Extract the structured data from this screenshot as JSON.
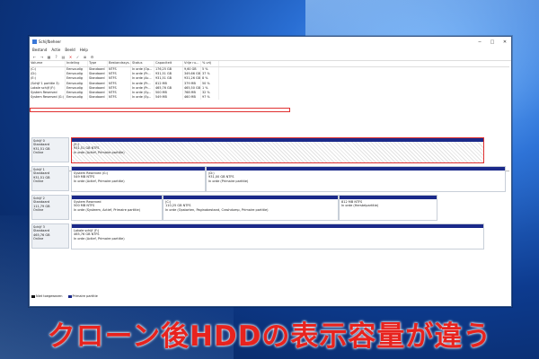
{
  "window": {
    "title": "Schijfbeheer"
  },
  "menu": [
    "Bestand",
    "Actie",
    "Beeld",
    "Help"
  ],
  "toolbar": [
    "back-icon",
    "forward-icon",
    "grid-icon",
    "help-icon",
    "properties-icon",
    "delete-icon",
    "check-icon",
    "list-icon",
    "settings-icon"
  ],
  "volumes": {
    "headers": [
      "Volume",
      "Indeling",
      "Type",
      "Bestandssys...",
      "Status",
      "Capaciteit",
      "Vrije ru...",
      "% vrij"
    ],
    "rows": [
      [
        "(C:)",
        "Eenvoudig",
        "Standaard",
        "NTFS",
        "In orde (Op...",
        "176,25 GB",
        "9,60 GB",
        "5 %"
      ],
      [
        "(D:)",
        "Eenvoudig",
        "Standaard",
        "NTFS",
        "In orde (Pr...",
        "931,51 GB",
        "349,66 GB",
        "37 %"
      ],
      [
        "(E:)",
        "Eenvoudig",
        "Standaard",
        "NTFS",
        "In orde (Ac...",
        "931,51 GB",
        "931,26 GB",
        "8 %"
      ],
      [
        "(Schijf 1 partitie 3)",
        "Eenvoudig",
        "Standaard",
        "NTFS",
        "In orde (Pr...",
        "812 MB",
        "379 MB",
        "50 %"
      ],
      [
        "Lokale schijf (F:)",
        "Eenvoudig",
        "Standaard",
        "NTFS",
        "In orde (Pr...",
        "465,76 GB",
        "465,50 GB",
        "1 %"
      ],
      [
        "System Reserved",
        "Eenvoudig",
        "Standaard",
        "NTFS",
        "In orde (Sy...",
        "500 MB",
        "768 MB",
        "32 %"
      ],
      [
        "System Reserved (G:)",
        "Eenvoudig",
        "Standaard",
        "NTFS",
        "In orde (Sy...",
        "549 MB",
        "460 MB",
        "97 %"
      ]
    ]
  },
  "disks": [
    {
      "label": [
        "Schijf 0",
        "Standaard",
        "931,51 GB",
        "Online"
      ],
      "parts": [
        {
          "t1": "(E:)",
          "t2": "931,51 GB NTFS",
          "t3": "In orde (Actief, Primaire partitie)"
        }
      ]
    },
    {
      "label": [
        "Schijf 1",
        "Standaard",
        "931,51 GB",
        "Online"
      ],
      "parts": [
        {
          "t1": "System Reserved (G:)",
          "t2": "549 MB NTFS",
          "t3": "In orde (Actief, Primaire partitie)"
        },
        {
          "t1": "(D:)",
          "t2": "931,00 GB NTFS",
          "t3": "In orde (Primaire partitie)"
        }
      ]
    },
    {
      "label": [
        "Schijf 2",
        "Standaard",
        "111,79 GB",
        "Online"
      ],
      "parts": [
        {
          "t1": "System Reserved",
          "t2": "500 MB NTFS",
          "t3": "In orde (Systeem, Actief, Primaire partitie)"
        },
        {
          "t1": "(C:)",
          "t2": "110,25 GB NTFS",
          "t3": "In orde (Opstarten, Paginabestand, Crashdump, Primaire partitie)"
        },
        {
          "t1": "",
          "t2": "812 MB NTFS",
          "t3": "In orde (Herstelpartitie)"
        }
      ]
    },
    {
      "label": [
        "Schijf 3",
        "Standaard",
        "465,76 GB",
        "Online"
      ],
      "parts": [
        {
          "t1": "Lokale schijf (F:)",
          "t2": "465,76 GB NTFS",
          "t3": "In orde (Actief, Primaire partitie)"
        }
      ]
    }
  ],
  "legend": {
    "unallocated": "Niet toegewezen",
    "primary": "Primaire partitie"
  },
  "caption": "クローン後HDDの表示容量が違う"
}
